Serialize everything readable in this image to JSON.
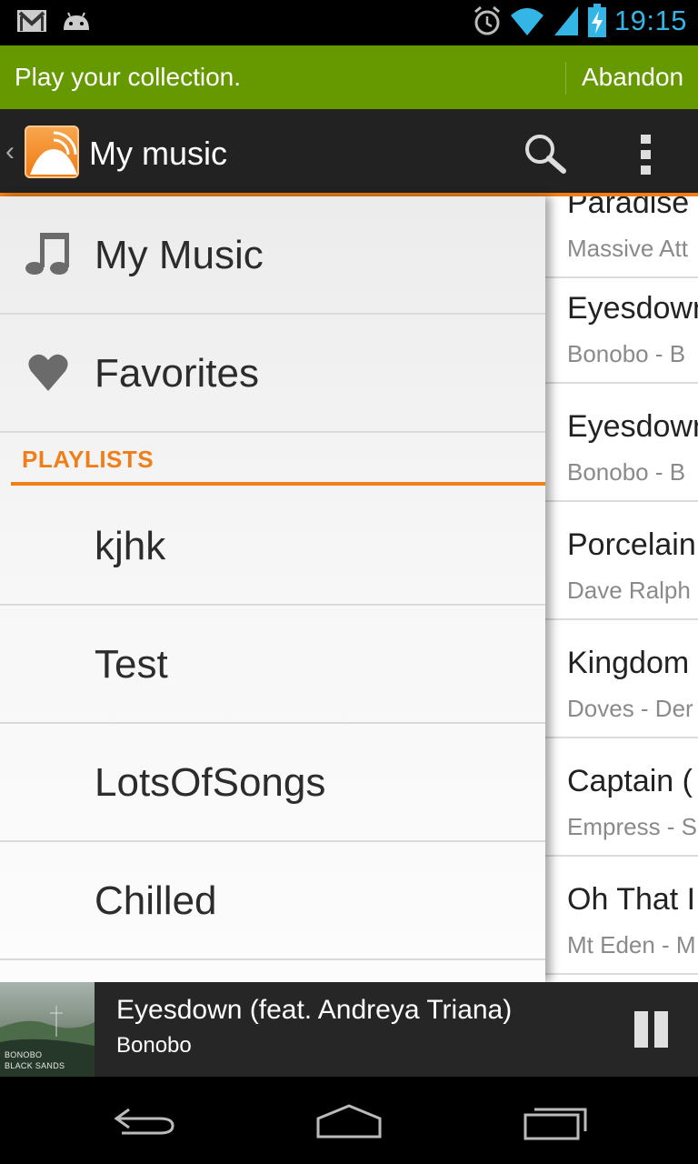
{
  "status_bar": {
    "time": "19:15",
    "icons": [
      "gmail-icon",
      "android-icon",
      "alarm-icon",
      "wifi-icon",
      "signal-icon",
      "battery-charging-icon"
    ]
  },
  "cast_banner": {
    "message": "Play your collection.",
    "action_label": "Abandon",
    "color": "#669900"
  },
  "action_bar": {
    "title": "My music",
    "accent_color": "#f07f1a",
    "actions": [
      "search-icon",
      "overflow-menu-icon"
    ]
  },
  "drawer": {
    "items": [
      {
        "label": "My Music",
        "icon": "music-note-icon"
      },
      {
        "label": "Favorites",
        "icon": "heart-icon"
      }
    ],
    "playlists_header": "PLAYLISTS",
    "playlists": [
      "kjhk",
      "Test",
      "LotsOfSongs",
      "Chilled"
    ]
  },
  "song_list": [
    {
      "title": "Paradise",
      "subtitle": "Massive Att"
    },
    {
      "title": "Eyesdowr",
      "subtitle": "Bonobo - B"
    },
    {
      "title": "Eyesdowr",
      "subtitle": "Bonobo - B"
    },
    {
      "title": "Porcelain",
      "subtitle": "Dave Ralph"
    },
    {
      "title": "Kingdom",
      "subtitle": "Doves - Der"
    },
    {
      "title": "Captain (",
      "subtitle": "Empress - S"
    },
    {
      "title": "Oh That I",
      "subtitle": "Mt Eden - M"
    }
  ],
  "now_playing": {
    "title": "Eyesdown (feat. Andreya Triana)",
    "artist": "Bonobo",
    "album_art_text": [
      "BONOBO",
      "BLACK SANDS"
    ],
    "control": "pause-icon"
  },
  "system_nav": [
    "back-icon",
    "home-icon",
    "recent-apps-icon"
  ]
}
